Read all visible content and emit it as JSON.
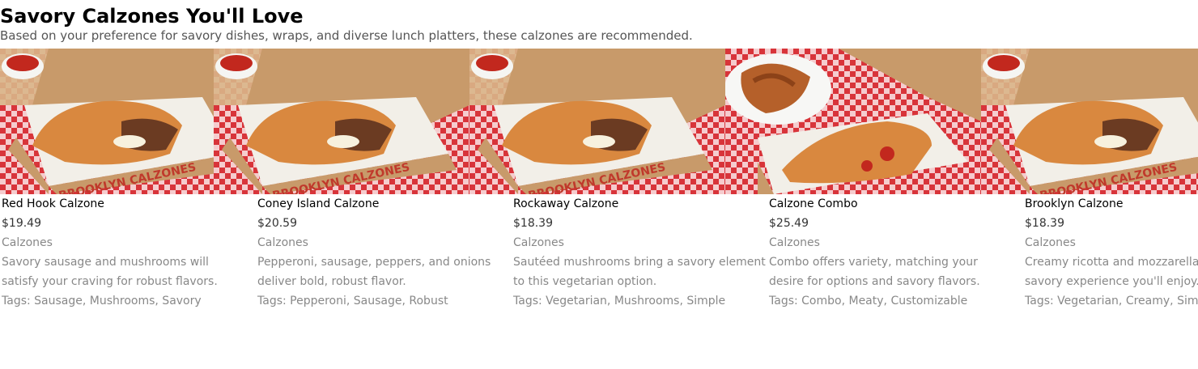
{
  "section": {
    "title": "Savory Calzones You'll Love",
    "subtitle": "Based on your preference for savory dishes, wraps, and diverse lunch platters, these calzones are recommended."
  },
  "colors": {
    "checker_red": "#d8343a",
    "box_cardboard": "#c89a6a",
    "box_red_text": "#c0392b",
    "crust": "#d9883f",
    "sauce": "#c2281e",
    "wood": "#d9b68a"
  },
  "products": [
    {
      "name": "Red Hook Calzone",
      "price": "$19.49",
      "category": "Calzones",
      "desc_line1": "Savory sausage and mushrooms will",
      "desc_line2": "satisfy your craving for robust flavors.",
      "tags": "Tags: Sausage, Mushrooms, Savory",
      "box_text": "BROOKLYN CALZONES",
      "image_icon": "calzone-box-photo"
    },
    {
      "name": "Coney Island Calzone",
      "price": "$20.59",
      "category": "Calzones",
      "desc_line1": "Pepperoni, sausage, peppers, and onions",
      "desc_line2": "deliver bold, robust flavor.",
      "tags": "Tags: Pepperoni, Sausage, Robust",
      "box_text": "BROOKLYN CALZONES",
      "image_icon": "calzone-box-photo"
    },
    {
      "name": "Rockaway Calzone",
      "price": "$18.39",
      "category": "Calzones",
      "desc_line1": "Sautéed mushrooms bring a savory element",
      "desc_line2": "to this vegetarian option.",
      "tags": "Tags: Vegetarian, Mushrooms, Simple",
      "box_text": "BROOKLYN CALZONES",
      "image_icon": "calzone-box-photo"
    },
    {
      "name": "Calzone Combo",
      "price": "$25.49",
      "category": "Calzones",
      "desc_line1": "Combo offers variety, matching your",
      "desc_line2": "desire for options and savory flavors.",
      "tags": "Tags: Combo, Meaty, Customizable",
      "box_text": "",
      "image_icon": "calzone-wings-photo"
    },
    {
      "name": "Brooklyn Calzone",
      "price": "$18.39",
      "category": "Calzones",
      "desc_line1": "Creamy ricotta and mozzarella offer a",
      "desc_line2": "savory experience you'll enjoy.",
      "tags": "Tags: Vegetarian, Creamy, Simple",
      "box_text": "BROOKLYN CALZONES",
      "image_icon": "calzone-box-photo"
    }
  ]
}
